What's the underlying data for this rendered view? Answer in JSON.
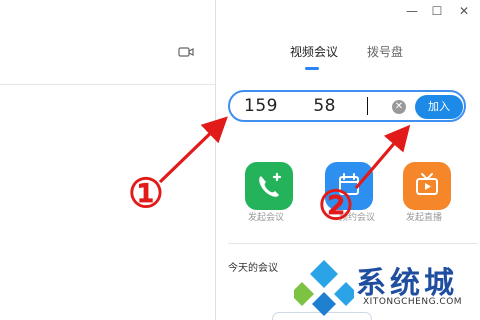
{
  "window_controls": {
    "minimize": "—",
    "maximize": "☐",
    "close": "✕"
  },
  "tabs": [
    {
      "label": "视频会议",
      "active": true
    },
    {
      "label": "拨号盘",
      "active": false
    }
  ],
  "meeting_input": {
    "value": "159      58"
  },
  "join_button": {
    "label": "加入"
  },
  "actions": [
    {
      "label": "发起会议",
      "icon": "phone-plus-icon",
      "color": "#24b35b"
    },
    {
      "label": "预约会议",
      "icon": "calendar-icon",
      "color": "#2d8ff0"
    },
    {
      "label": "发起直播",
      "icon": "tv-play-icon",
      "color": "#f5862a"
    }
  ],
  "today": {
    "title": "今天的会议"
  },
  "annotations": {
    "one": "①",
    "two": "②",
    "color": "#e21a1a"
  },
  "watermark": {
    "text": "系统城",
    "url": "XITONGCHENG.COM"
  },
  "colors": {
    "accent": "#2b83f6",
    "join_button": "#1d8ae8"
  }
}
